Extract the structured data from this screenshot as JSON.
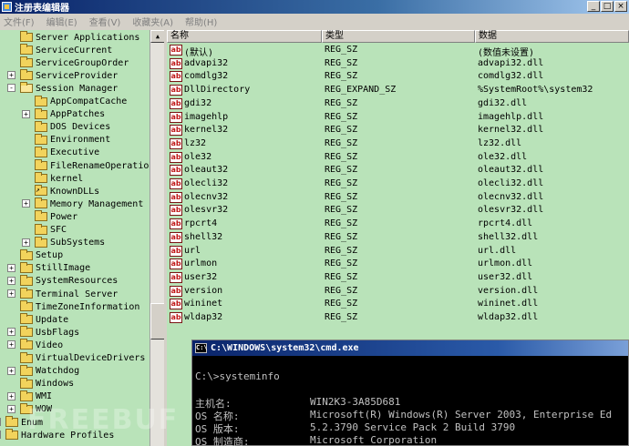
{
  "window": {
    "title": "注册表编辑器"
  },
  "menu": [
    "文件(F)",
    "编辑(E)",
    "查看(V)",
    "收藏夹(A)",
    "帮助(H)"
  ],
  "tree": [
    {
      "label": "Server Applications",
      "level": 2,
      "exp": ""
    },
    {
      "label": "ServiceCurrent",
      "level": 2,
      "exp": ""
    },
    {
      "label": "ServiceGroupOrder",
      "level": 2,
      "exp": ""
    },
    {
      "label": "ServiceProvider",
      "level": 2,
      "exp": "+"
    },
    {
      "label": "Session Manager",
      "level": 2,
      "exp": "-",
      "open": true
    },
    {
      "label": "AppCompatCache",
      "level": 3,
      "exp": ""
    },
    {
      "label": "AppPatches",
      "level": 3,
      "exp": "+"
    },
    {
      "label": "DOS Devices",
      "level": 3,
      "exp": ""
    },
    {
      "label": "Environment",
      "level": 3,
      "exp": ""
    },
    {
      "label": "Executive",
      "level": 3,
      "exp": ""
    },
    {
      "label": "FileRenameOperations",
      "level": 3,
      "exp": ""
    },
    {
      "label": "kernel",
      "level": 3,
      "exp": ""
    },
    {
      "label": "KnownDLLs",
      "level": 3,
      "exp": "",
      "shortcut": true
    },
    {
      "label": "Memory Management",
      "level": 3,
      "exp": "+"
    },
    {
      "label": "Power",
      "level": 3,
      "exp": ""
    },
    {
      "label": "SFC",
      "level": 3,
      "exp": ""
    },
    {
      "label": "SubSystems",
      "level": 3,
      "exp": "+"
    },
    {
      "label": "Setup",
      "level": 2,
      "exp": ""
    },
    {
      "label": "StillImage",
      "level": 2,
      "exp": "+"
    },
    {
      "label": "SystemResources",
      "level": 2,
      "exp": "+"
    },
    {
      "label": "Terminal Server",
      "level": 2,
      "exp": "+"
    },
    {
      "label": "TimeZoneInformation",
      "level": 2,
      "exp": ""
    },
    {
      "label": "Update",
      "level": 2,
      "exp": ""
    },
    {
      "label": "UsbFlags",
      "level": 2,
      "exp": "+"
    },
    {
      "label": "Video",
      "level": 2,
      "exp": "+"
    },
    {
      "label": "VirtualDeviceDrivers",
      "level": 2,
      "exp": ""
    },
    {
      "label": "Watchdog",
      "level": 2,
      "exp": "+"
    },
    {
      "label": "Windows",
      "level": 2,
      "exp": ""
    },
    {
      "label": "WMI",
      "level": 2,
      "exp": "+"
    },
    {
      "label": "WOW",
      "level": 2,
      "exp": "+"
    },
    {
      "label": "Enum",
      "level": 1,
      "exp": "+"
    },
    {
      "label": "Hardware Profiles",
      "level": 1,
      "exp": "+"
    }
  ],
  "columns": [
    "名称",
    "类型",
    "数据"
  ],
  "values": [
    {
      "name": "(默认)",
      "type": "REG_SZ",
      "data": "(数值未设置)"
    },
    {
      "name": "advapi32",
      "type": "REG_SZ",
      "data": "advapi32.dll"
    },
    {
      "name": "comdlg32",
      "type": "REG_SZ",
      "data": "comdlg32.dll"
    },
    {
      "name": "DllDirectory",
      "type": "REG_EXPAND_SZ",
      "data": "%SystemRoot%\\system32"
    },
    {
      "name": "gdi32",
      "type": "REG_SZ",
      "data": "gdi32.dll"
    },
    {
      "name": "imagehlp",
      "type": "REG_SZ",
      "data": "imagehlp.dll"
    },
    {
      "name": "kernel32",
      "type": "REG_SZ",
      "data": "kernel32.dll"
    },
    {
      "name": "lz32",
      "type": "REG_SZ",
      "data": "lz32.dll"
    },
    {
      "name": "ole32",
      "type": "REG_SZ",
      "data": "ole32.dll"
    },
    {
      "name": "oleaut32",
      "type": "REG_SZ",
      "data": "oleaut32.dll"
    },
    {
      "name": "olecli32",
      "type": "REG_SZ",
      "data": "olecli32.dll"
    },
    {
      "name": "olecnv32",
      "type": "REG_SZ",
      "data": "olecnv32.dll"
    },
    {
      "name": "olesvr32",
      "type": "REG_SZ",
      "data": "olesvr32.dll"
    },
    {
      "name": "rpcrt4",
      "type": "REG_SZ",
      "data": "rpcrt4.dll"
    },
    {
      "name": "shell32",
      "type": "REG_SZ",
      "data": "shell32.dll"
    },
    {
      "name": "url",
      "type": "REG_SZ",
      "data": "url.dll"
    },
    {
      "name": "urlmon",
      "type": "REG_SZ",
      "data": "urlmon.dll"
    },
    {
      "name": "user32",
      "type": "REG_SZ",
      "data": "user32.dll"
    },
    {
      "name": "version",
      "type": "REG_SZ",
      "data": "version.dll"
    },
    {
      "name": "wininet",
      "type": "REG_SZ",
      "data": "wininet.dll"
    },
    {
      "name": "wldap32",
      "type": "REG_SZ",
      "data": "wldap32.dll"
    }
  ],
  "cmd": {
    "title": "C:\\WINDOWS\\system32\\cmd.exe",
    "prompt": "C:\\>systeminfo",
    "rows": [
      {
        "label": "主机名:",
        "value": "WIN2K3-3A85D681"
      },
      {
        "label": "OS 名称:",
        "value": "Microsoft(R) Windows(R) Server 2003, Enterprise Ed"
      },
      {
        "label": "OS 版本:",
        "value": "5.2.3790 Service Pack 2 Build 3790"
      },
      {
        "label": "OS 制造商:",
        "value": "Microsoft Corporation"
      }
    ]
  },
  "watermark": "FREEBUF"
}
